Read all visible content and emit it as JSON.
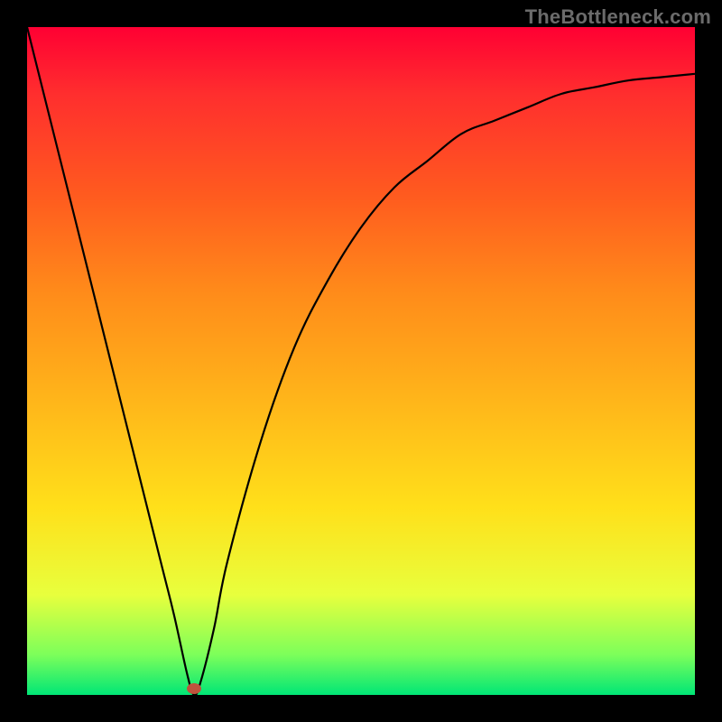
{
  "watermark": "TheBottleneck.com",
  "colors": {
    "top": "#ff0033",
    "mid": "#ffdd1a",
    "bottom": "#00e676",
    "curve": "#000000",
    "marker": "#c0533d",
    "frame": "#000000"
  },
  "chart_data": {
    "type": "line",
    "title": "",
    "xlabel": "",
    "ylabel": "",
    "xlim": [
      0,
      100
    ],
    "ylim": [
      0,
      100
    ],
    "grid": false,
    "legend": false,
    "annotations": [
      "TheBottleneck.com"
    ],
    "series": [
      {
        "name": "bottleneck-curve",
        "x": [
          0,
          5,
          10,
          15,
          20,
          22,
          24,
          25,
          26,
          28,
          30,
          35,
          40,
          45,
          50,
          55,
          60,
          65,
          70,
          75,
          80,
          85,
          90,
          95,
          100
        ],
        "y": [
          100,
          80,
          60,
          40,
          20,
          12,
          3,
          0,
          2,
          10,
          20,
          38,
          52,
          62,
          70,
          76,
          80,
          84,
          86,
          88,
          90,
          91,
          92,
          92.5,
          93
        ]
      }
    ],
    "marker": {
      "x": 25,
      "y": 1
    },
    "gradient_stops": [
      {
        "pos": 0,
        "color": "#ff0033"
      },
      {
        "pos": 10,
        "color": "#ff2e2e"
      },
      {
        "pos": 25,
        "color": "#ff5a1f"
      },
      {
        "pos": 40,
        "color": "#ff8c1a"
      },
      {
        "pos": 55,
        "color": "#ffb31a"
      },
      {
        "pos": 72,
        "color": "#ffe01a"
      },
      {
        "pos": 85,
        "color": "#e8ff3d"
      },
      {
        "pos": 94,
        "color": "#7cff5a"
      },
      {
        "pos": 100,
        "color": "#00e676"
      }
    ]
  }
}
